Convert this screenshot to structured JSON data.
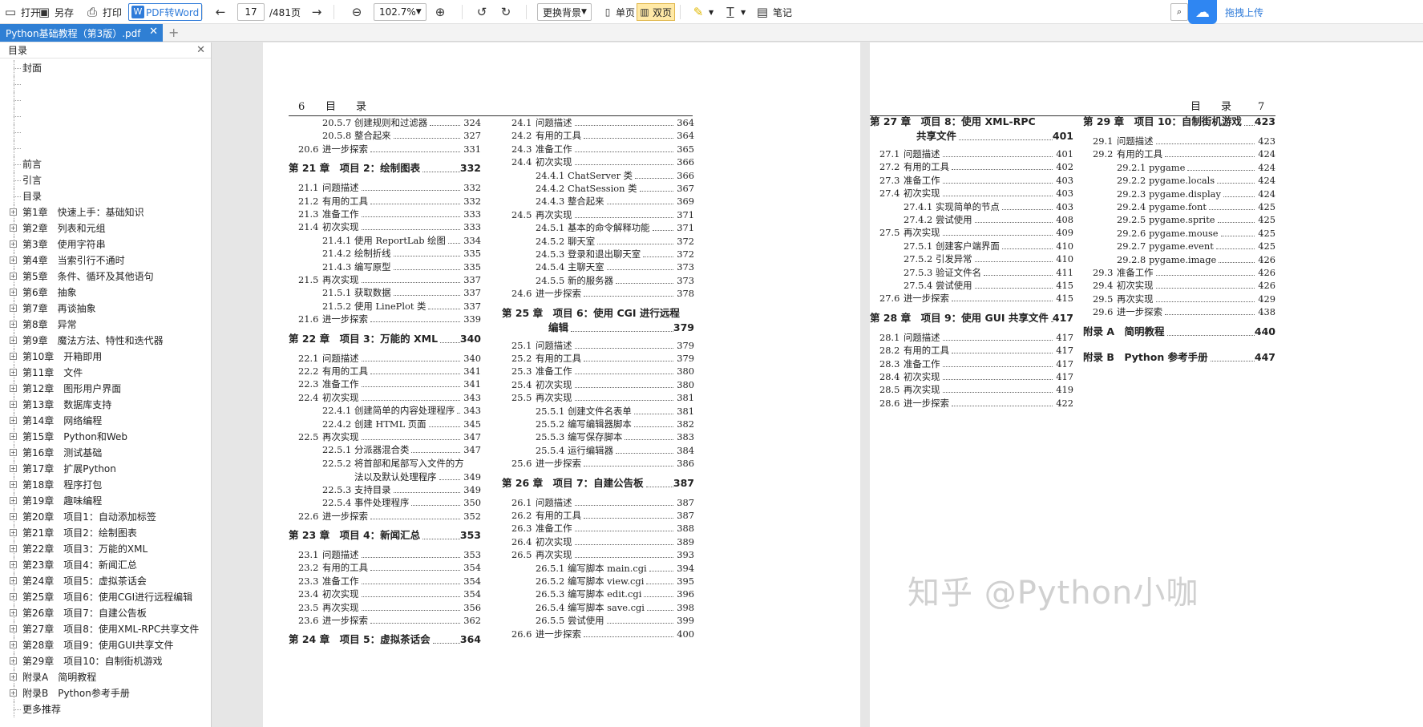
{
  "toolbar": {
    "open": "打开",
    "save_as": "另存",
    "print": "打印",
    "pdf_to_word": "PDF转Word",
    "page_current": "17",
    "page_total": "/481页",
    "zoom": "102.7%",
    "change_bg": "更换背景",
    "single_page": "单页",
    "double_page": "双页",
    "notes": "笔记",
    "drag_upload": "拖拽上传"
  },
  "tab": {
    "title": "Python基础教程（第3版）.pdf"
  },
  "sidebar": {
    "title": "目录",
    "items": [
      {
        "label": "封面",
        "expandable": false
      },
      {
        "label": "",
        "expandable": false
      },
      {
        "label": "",
        "expandable": false
      },
      {
        "label": "",
        "expandable": false
      },
      {
        "label": "",
        "expandable": false
      },
      {
        "label": "",
        "expandable": false
      },
      {
        "label": "前言",
        "expandable": false
      },
      {
        "label": "引言",
        "expandable": false
      },
      {
        "label": "目录",
        "expandable": false
      },
      {
        "label": "第1章　快速上手：基础知识",
        "expandable": true
      },
      {
        "label": "第2章　列表和元组",
        "expandable": true
      },
      {
        "label": "第3章　使用字符串",
        "expandable": true
      },
      {
        "label": "第4章　当索引行不通时",
        "expandable": true
      },
      {
        "label": "第5章　条件、循环及其他语句",
        "expandable": true
      },
      {
        "label": "第6章　抽象",
        "expandable": true
      },
      {
        "label": "第7章　再谈抽象",
        "expandable": true
      },
      {
        "label": "第8章　异常",
        "expandable": true
      },
      {
        "label": "第9章　魔法方法、特性和迭代器",
        "expandable": true
      },
      {
        "label": "第10章　开箱即用",
        "expandable": true
      },
      {
        "label": "第11章　文件",
        "expandable": true
      },
      {
        "label": "第12章　图形用户界面",
        "expandable": true
      },
      {
        "label": "第13章　数据库支持",
        "expandable": true
      },
      {
        "label": "第14章　网络编程",
        "expandable": true
      },
      {
        "label": "第15章　Python和Web",
        "expandable": true
      },
      {
        "label": "第16章　测试基础",
        "expandable": true
      },
      {
        "label": "第17章　扩展Python",
        "expandable": true
      },
      {
        "label": "第18章　程序打包",
        "expandable": true
      },
      {
        "label": "第19章　趣味编程",
        "expandable": true
      },
      {
        "label": "第20章　项目1：自动添加标签",
        "expandable": true
      },
      {
        "label": "第21章　项目2：绘制图表",
        "expandable": true
      },
      {
        "label": "第22章　项目3：万能的XML",
        "expandable": true
      },
      {
        "label": "第23章　项目4：新闻汇总",
        "expandable": true
      },
      {
        "label": "第24章　项目5：虚拟茶话会",
        "expandable": true
      },
      {
        "label": "第25章　项目6：使用CGI进行远程编辑",
        "expandable": true
      },
      {
        "label": "第26章　项目7：自建公告板",
        "expandable": true
      },
      {
        "label": "第27章　项目8：使用XML-RPC共享文件",
        "expandable": true
      },
      {
        "label": "第28章　项目9：使用GUI共享文件",
        "expandable": true
      },
      {
        "label": "第29章　项目10：自制街机游戏",
        "expandable": true
      },
      {
        "label": "附录A　简明教程",
        "expandable": true
      },
      {
        "label": "附录B　Python参考手册",
        "expandable": true
      },
      {
        "label": "更多推荐",
        "expandable": false
      }
    ]
  },
  "left_page": {
    "header_num": "6",
    "header_title": "目　录",
    "col1": [
      {
        "lvl": 3,
        "num": "20.5.7",
        "text": "创建规则和过滤器",
        "page": "324"
      },
      {
        "lvl": 3,
        "num": "20.5.8",
        "text": "整合起来",
        "page": "327"
      },
      {
        "lvl": 2,
        "num": "20.6",
        "text": "进一步探索",
        "page": "331"
      },
      {
        "lvl": 1,
        "num": "",
        "text": "第 21 章　项目 2：绘制图表",
        "page": "332"
      },
      {
        "lvl": 2,
        "num": "21.1",
        "text": "问题描述",
        "page": "332"
      },
      {
        "lvl": 2,
        "num": "21.2",
        "text": "有用的工具",
        "page": "332"
      },
      {
        "lvl": 2,
        "num": "21.3",
        "text": "准备工作",
        "page": "333"
      },
      {
        "lvl": 2,
        "num": "21.4",
        "text": "初次实现",
        "page": "333"
      },
      {
        "lvl": 3,
        "num": "21.4.1",
        "text": "使用 ReportLab 绘图",
        "page": "334"
      },
      {
        "lvl": 3,
        "num": "21.4.2",
        "text": "绘制折线",
        "page": "335"
      },
      {
        "lvl": 3,
        "num": "21.4.3",
        "text": "编写原型",
        "page": "335"
      },
      {
        "lvl": 2,
        "num": "21.5",
        "text": "再次实现",
        "page": "337"
      },
      {
        "lvl": 3,
        "num": "21.5.1",
        "text": "获取数据",
        "page": "337"
      },
      {
        "lvl": 3,
        "num": "21.5.2",
        "text": "使用 LinePlot 类",
        "page": "337"
      },
      {
        "lvl": 2,
        "num": "21.6",
        "text": "进一步探索",
        "page": "339"
      },
      {
        "lvl": 1,
        "num": "",
        "text": "第 22 章　项目 3：万能的 XML",
        "page": "340"
      },
      {
        "lvl": 2,
        "num": "22.1",
        "text": "问题描述",
        "page": "340"
      },
      {
        "lvl": 2,
        "num": "22.2",
        "text": "有用的工具",
        "page": "341"
      },
      {
        "lvl": 2,
        "num": "22.3",
        "text": "准备工作",
        "page": "341"
      },
      {
        "lvl": 2,
        "num": "22.4",
        "text": "初次实现",
        "page": "343"
      },
      {
        "lvl": 3,
        "num": "22.4.1",
        "text": "创建简单的内容处理程序",
        "page": "343"
      },
      {
        "lvl": 3,
        "num": "22.4.2",
        "text": "创建 HTML 页面",
        "page": "345"
      },
      {
        "lvl": 2,
        "num": "22.5",
        "text": "再次实现",
        "page": "347"
      },
      {
        "lvl": 3,
        "num": "22.5.1",
        "text": "分派器混合类",
        "page": "347"
      },
      {
        "lvl": 3,
        "num": "22.5.2",
        "text": "将首部和尾部写入文件的方",
        "text2": "法以及默认处理程序",
        "page": "349"
      },
      {
        "lvl": 3,
        "num": "22.5.3",
        "text": "支持目录",
        "page": "349"
      },
      {
        "lvl": 3,
        "num": "22.5.4",
        "text": "事件处理程序",
        "page": "350"
      },
      {
        "lvl": 2,
        "num": "22.6",
        "text": "进一步探索",
        "page": "352"
      },
      {
        "lvl": 1,
        "num": "",
        "text": "第 23 章　项目 4：新闻汇总",
        "page": "353"
      },
      {
        "lvl": 2,
        "num": "23.1",
        "text": "问题描述",
        "page": "353"
      },
      {
        "lvl": 2,
        "num": "23.2",
        "text": "有用的工具",
        "page": "354"
      },
      {
        "lvl": 2,
        "num": "23.3",
        "text": "准备工作",
        "page": "354"
      },
      {
        "lvl": 2,
        "num": "23.4",
        "text": "初次实现",
        "page": "354"
      },
      {
        "lvl": 2,
        "num": "23.5",
        "text": "再次实现",
        "page": "356"
      },
      {
        "lvl": 2,
        "num": "23.6",
        "text": "进一步探索",
        "page": "362"
      },
      {
        "lvl": 1,
        "num": "",
        "text": "第 24 章　项目 5：虚拟茶话会",
        "page": "364"
      }
    ],
    "col2": [
      {
        "lvl": 2,
        "num": "24.1",
        "text": "问题描述",
        "page": "364"
      },
      {
        "lvl": 2,
        "num": "24.2",
        "text": "有用的工具",
        "page": "364"
      },
      {
        "lvl": 2,
        "num": "24.3",
        "text": "准备工作",
        "page": "365"
      },
      {
        "lvl": 2,
        "num": "24.4",
        "text": "初次实现",
        "page": "366"
      },
      {
        "lvl": 3,
        "num": "24.4.1",
        "text": "ChatServer 类",
        "page": "366"
      },
      {
        "lvl": 3,
        "num": "24.4.2",
        "text": "ChatSession 类",
        "page": "367"
      },
      {
        "lvl": 3,
        "num": "24.4.3",
        "text": "整合起来",
        "page": "369"
      },
      {
        "lvl": 2,
        "num": "24.5",
        "text": "再次实现",
        "page": "371"
      },
      {
        "lvl": 3,
        "num": "24.5.1",
        "text": "基本的命令解释功能",
        "page": "371"
      },
      {
        "lvl": 3,
        "num": "24.5.2",
        "text": "聊天室",
        "page": "372"
      },
      {
        "lvl": 3,
        "num": "24.5.3",
        "text": "登录和退出聊天室",
        "page": "372"
      },
      {
        "lvl": 3,
        "num": "24.5.4",
        "text": "主聊天室",
        "page": "373"
      },
      {
        "lvl": 3,
        "num": "24.5.5",
        "text": "新的服务器",
        "page": "373"
      },
      {
        "lvl": 2,
        "num": "24.6",
        "text": "进一步探索",
        "page": "378"
      },
      {
        "lvl": 1,
        "num": "",
        "text": "第 25 章　项目 6：使用 CGI 进行远程",
        "text2": "编辑",
        "page": "379"
      },
      {
        "lvl": 2,
        "num": "25.1",
        "text": "问题描述",
        "page": "379"
      },
      {
        "lvl": 2,
        "num": "25.2",
        "text": "有用的工具",
        "page": "379"
      },
      {
        "lvl": 2,
        "num": "25.3",
        "text": "准备工作",
        "page": "380"
      },
      {
        "lvl": 2,
        "num": "25.4",
        "text": "初次实现",
        "page": "380"
      },
      {
        "lvl": 2,
        "num": "25.5",
        "text": "再次实现",
        "page": "381"
      },
      {
        "lvl": 3,
        "num": "25.5.1",
        "text": "创建文件名表单",
        "page": "381"
      },
      {
        "lvl": 3,
        "num": "25.5.2",
        "text": "编写编辑器脚本",
        "page": "382"
      },
      {
        "lvl": 3,
        "num": "25.5.3",
        "text": "编写保存脚本",
        "page": "383"
      },
      {
        "lvl": 3,
        "num": "25.5.4",
        "text": "运行编辑器",
        "page": "384"
      },
      {
        "lvl": 2,
        "num": "25.6",
        "text": "进一步探索",
        "page": "386"
      },
      {
        "lvl": 1,
        "num": "",
        "text": "第 26 章　项目 7：自建公告板",
        "page": "387"
      },
      {
        "lvl": 2,
        "num": "26.1",
        "text": "问题描述",
        "page": "387"
      },
      {
        "lvl": 2,
        "num": "26.2",
        "text": "有用的工具",
        "page": "387"
      },
      {
        "lvl": 2,
        "num": "26.3",
        "text": "准备工作",
        "page": "388"
      },
      {
        "lvl": 2,
        "num": "26.4",
        "text": "初次实现",
        "page": "389"
      },
      {
        "lvl": 2,
        "num": "26.5",
        "text": "再次实现",
        "page": "393"
      },
      {
        "lvl": 3,
        "num": "26.5.1",
        "text": "编写脚本 main.cgi",
        "page": "394"
      },
      {
        "lvl": 3,
        "num": "26.5.2",
        "text": "编写脚本 view.cgi",
        "page": "395"
      },
      {
        "lvl": 3,
        "num": "26.5.3",
        "text": "编写脚本 edit.cgi",
        "page": "396"
      },
      {
        "lvl": 3,
        "num": "26.5.4",
        "text": "编写脚本 save.cgi",
        "page": "398"
      },
      {
        "lvl": 3,
        "num": "26.5.5",
        "text": "尝试使用",
        "page": "399"
      },
      {
        "lvl": 2,
        "num": "26.6",
        "text": "进一步探索",
        "page": "400"
      }
    ]
  },
  "right_page": {
    "header_num": "7",
    "header_title": "目　录",
    "col1": [
      {
        "lvl": 1,
        "num": "",
        "text": "第 27 章　项目 8：使用 XML-RPC",
        "text2": "共享文件",
        "page": "401"
      },
      {
        "lvl": 2,
        "num": "27.1",
        "text": "问题描述",
        "page": "401"
      },
      {
        "lvl": 2,
        "num": "27.2",
        "text": "有用的工具",
        "page": "402"
      },
      {
        "lvl": 2,
        "num": "27.3",
        "text": "准备工作",
        "page": "403"
      },
      {
        "lvl": 2,
        "num": "27.4",
        "text": "初次实现",
        "page": "403"
      },
      {
        "lvl": 3,
        "num": "27.4.1",
        "text": "实现简单的节点",
        "page": "403"
      },
      {
        "lvl": 3,
        "num": "27.4.2",
        "text": "尝试使用",
        "page": "408"
      },
      {
        "lvl": 2,
        "num": "27.5",
        "text": "再次实现",
        "page": "409"
      },
      {
        "lvl": 3,
        "num": "27.5.1",
        "text": "创建客户端界面",
        "page": "410"
      },
      {
        "lvl": 3,
        "num": "27.5.2",
        "text": "引发异常",
        "page": "410"
      },
      {
        "lvl": 3,
        "num": "27.5.3",
        "text": "验证文件名",
        "page": "411"
      },
      {
        "lvl": 3,
        "num": "27.5.4",
        "text": "尝试使用",
        "page": "415"
      },
      {
        "lvl": 2,
        "num": "27.6",
        "text": "进一步探索",
        "page": "415"
      },
      {
        "lvl": 1,
        "num": "",
        "text": "第 28 章　项目 9：使用 GUI 共享文件",
        "page": "417"
      },
      {
        "lvl": 2,
        "num": "28.1",
        "text": "问题描述",
        "page": "417"
      },
      {
        "lvl": 2,
        "num": "28.2",
        "text": "有用的工具",
        "page": "417"
      },
      {
        "lvl": 2,
        "num": "28.3",
        "text": "准备工作",
        "page": "417"
      },
      {
        "lvl": 2,
        "num": "28.4",
        "text": "初次实现",
        "page": "417"
      },
      {
        "lvl": 2,
        "num": "28.5",
        "text": "再次实现",
        "page": "419"
      },
      {
        "lvl": 2,
        "num": "28.6",
        "text": "进一步探索",
        "page": "422"
      }
    ],
    "col2": [
      {
        "lvl": 1,
        "num": "",
        "text": "第 29 章　项目 10：自制街机游戏",
        "page": "423"
      },
      {
        "lvl": 2,
        "num": "29.1",
        "text": "问题描述",
        "page": "423"
      },
      {
        "lvl": 2,
        "num": "29.2",
        "text": "有用的工具",
        "page": "424"
      },
      {
        "lvl": 3,
        "num": "29.2.1",
        "text": "pygame",
        "page": "424"
      },
      {
        "lvl": 3,
        "num": "29.2.2",
        "text": "pygame.locals",
        "page": "424"
      },
      {
        "lvl": 3,
        "num": "29.2.3",
        "text": "pygame.display",
        "page": "424"
      },
      {
        "lvl": 3,
        "num": "29.2.4",
        "text": "pygame.font",
        "page": "425"
      },
      {
        "lvl": 3,
        "num": "29.2.5",
        "text": "pygame.sprite",
        "page": "425"
      },
      {
        "lvl": 3,
        "num": "29.2.6",
        "text": "pygame.mouse",
        "page": "425"
      },
      {
        "lvl": 3,
        "num": "29.2.7",
        "text": "pygame.event",
        "page": "425"
      },
      {
        "lvl": 3,
        "num": "29.2.8",
        "text": "pygame.image",
        "page": "426"
      },
      {
        "lvl": 2,
        "num": "29.3",
        "text": "准备工作",
        "page": "426"
      },
      {
        "lvl": 2,
        "num": "29.4",
        "text": "初次实现",
        "page": "426"
      },
      {
        "lvl": 2,
        "num": "29.5",
        "text": "再次实现",
        "page": "429"
      },
      {
        "lvl": 2,
        "num": "29.6",
        "text": "进一步探索",
        "page": "438"
      },
      {
        "lvl": 1,
        "num": "",
        "text": "附录 A　简明教程",
        "page": "440"
      },
      {
        "lvl": 1,
        "num": "",
        "text": "附录 B　Python 参考手册",
        "page": "447"
      }
    ]
  },
  "watermark": "知乎 @Python小咖"
}
